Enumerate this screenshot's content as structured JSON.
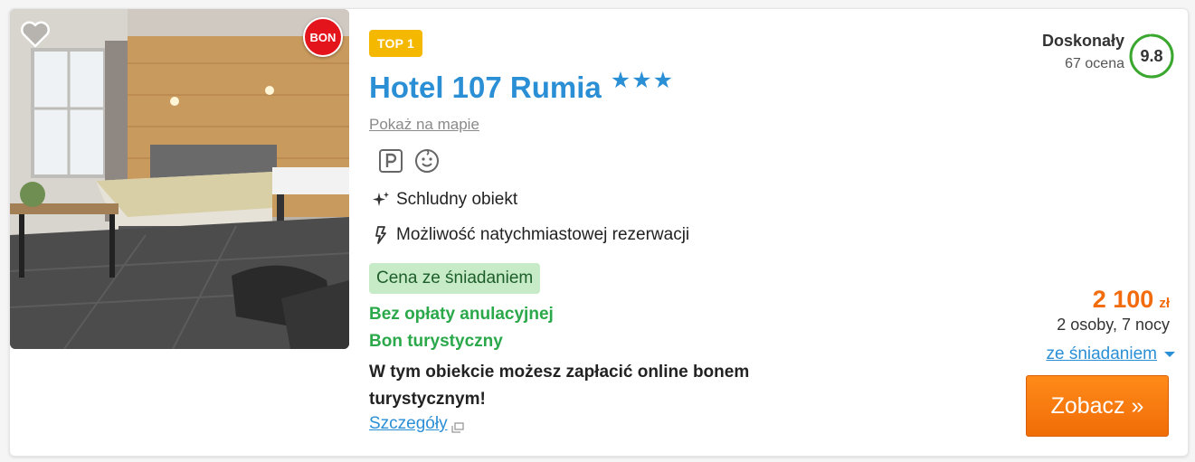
{
  "listing": {
    "badge": "TOP 1",
    "name": "Hotel 107 Rumia",
    "stars": "★★★",
    "star_count": 3,
    "map_link": "Pokaż na mapie",
    "bon_badge": "BON",
    "amenities": [
      "parking-icon",
      "kids-friendly-icon"
    ],
    "features": [
      {
        "icon": "sparkle-icon",
        "text": "Schludny obiekt"
      },
      {
        "icon": "lightning-icon",
        "text": "Możliwość natychmiastowej rezerwacji"
      }
    ],
    "meal_tag": "Cena ze śniadaniem",
    "free_cancel": "Bez opłaty anulacyjnej",
    "tourist_bon": "Bon turystyczny",
    "bon_description": "W tym obiekcie możesz zapłacić online bonem turystycznym!",
    "details_link": "Szczegóły"
  },
  "rating": {
    "label": "Doskonały",
    "count": "67 ocena",
    "score": "9.8",
    "score_value": 9.8
  },
  "pricing": {
    "price": "2 100",
    "currency": "zł",
    "stay": "2 osoby, 7 nocy",
    "meal_option": "ze śniadaniem",
    "cta": "Zobacz »"
  },
  "colors": {
    "accent_blue": "#2b8fd6",
    "price_orange": "#f26c0d",
    "badge_yellow": "#f5b800",
    "green": "#2aa84a",
    "score_ring": "#3aa82e",
    "bon_red": "#e3141b"
  }
}
